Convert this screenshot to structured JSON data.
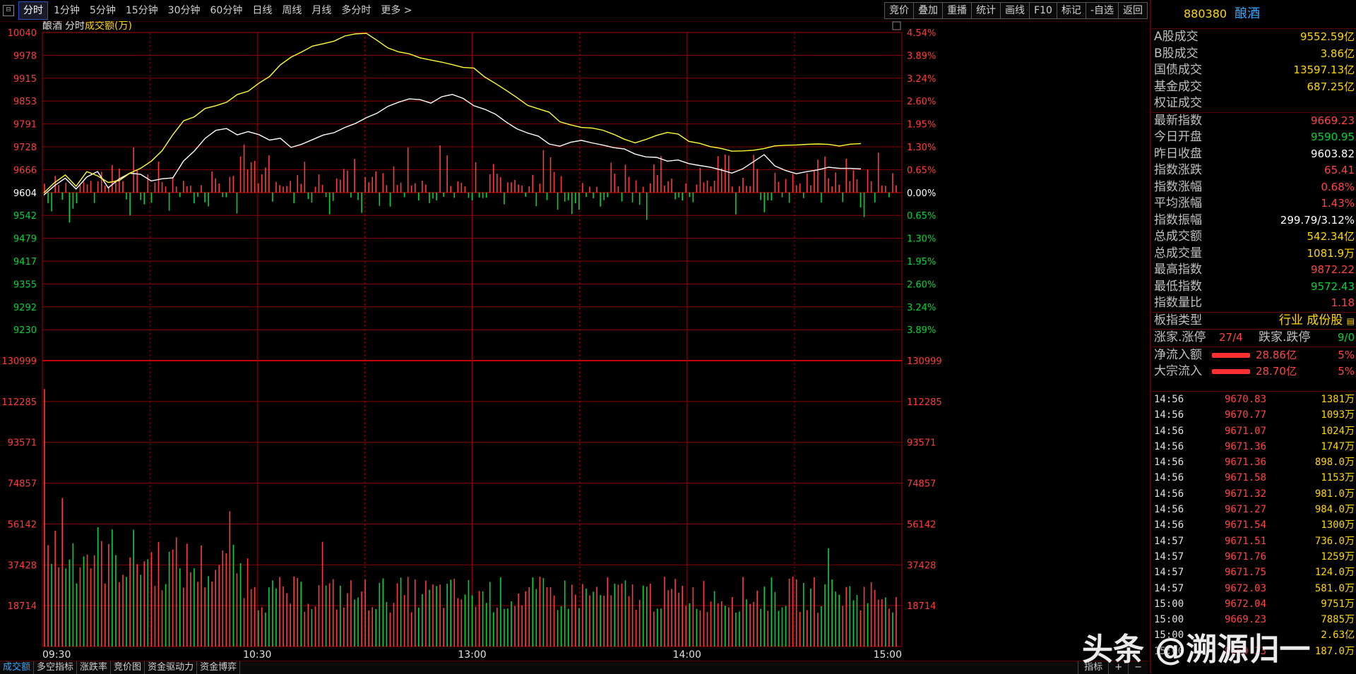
{
  "toolbar": {
    "periods": [
      "分时",
      "1分钟",
      "5分钟",
      "15分钟",
      "30分钟",
      "60分钟",
      "日线",
      "周线",
      "月线",
      "多分时",
      "更多 >"
    ],
    "active_period": "分时",
    "tools": [
      "竞价",
      "叠加",
      "重播",
      "统计",
      "画线",
      "F10",
      "标记",
      "-自选",
      "返回"
    ]
  },
  "chart_header": {
    "name": "酿酒",
    "mode": "分时",
    "vol_label": "成交额(万)"
  },
  "colors": {
    "up": "#ff3b3b",
    "down": "#00d43a",
    "price_line": "#ffffff",
    "avg_line": "#ffff33",
    "grid": "#8b0000",
    "neutral": "#ffffff"
  },
  "chart_data": [
    {
      "type": "line",
      "title": "",
      "xlabel": "",
      "ylabel": "",
      "ylim": [
        9168,
        10040
      ],
      "prev_close": 9604,
      "y_ticks": [
        "10040",
        "9978",
        "9915",
        "9853",
        "9791",
        "9728",
        "9666",
        "9604",
        "9542",
        "9479",
        "9417",
        "9355",
        "9292",
        "9230"
      ],
      "pct_ticks": [
        "4.54%",
        "3.89%",
        "3.24%",
        "2.60%",
        "1.95%",
        "1.30%",
        "0.65%",
        "0.00%",
        "0.65%",
        "1.30%",
        "1.95%",
        "2.60%",
        "3.24%",
        "3.89%"
      ],
      "x_ticks": [
        "09:30",
        "10:30",
        "13:00",
        "14:00",
        "15:00"
      ],
      "series": [
        {
          "name": "price",
          "color": "#ffffff",
          "values": [
            9600,
            9625,
            9640,
            9610,
            9650,
            9660,
            9620,
            9640,
            9660,
            9650,
            9635,
            9640,
            9645,
            9690,
            9720,
            9750,
            9770,
            9775,
            9760,
            9770,
            9760,
            9745,
            9750,
            9730,
            9735,
            9750,
            9760,
            9765,
            9780,
            9790,
            9805,
            9820,
            9840,
            9850,
            9860,
            9855,
            9850,
            9862,
            9870,
            9860,
            9840,
            9830,
            9820,
            9800,
            9780,
            9765,
            9755,
            9740,
            9730,
            9740,
            9745,
            9740,
            9730,
            9725,
            9720,
            9710,
            9700,
            9700,
            9690,
            9695,
            9680,
            9675,
            9670,
            9665,
            9660,
            9670,
            9690,
            9705,
            9680,
            9665,
            9655,
            9660,
            9665,
            9670,
            9668,
            9670,
            9669
          ]
        },
        {
          "name": "average",
          "color": "#ffff33",
          "values": [
            9600,
            9630,
            9650,
            9620,
            9660,
            9650,
            9630,
            9640,
            9660,
            9670,
            9690,
            9720,
            9760,
            9800,
            9810,
            9830,
            9840,
            9850,
            9870,
            9880,
            9900,
            9920,
            9950,
            9970,
            9990,
            10000,
            10010,
            10020,
            10030,
            10040,
            10035,
            10020,
            10000,
            9990,
            9980,
            9970,
            9965,
            9960,
            9950,
            9945,
            9940,
            9920,
            9900,
            9880,
            9860,
            9840,
            9830,
            9820,
            9800,
            9790,
            9785,
            9780,
            9770,
            9760,
            9750,
            9740,
            9745,
            9760,
            9770,
            9760,
            9745,
            9735,
            9730,
            9725,
            9720,
            9715,
            9720,
            9725,
            9728,
            9730,
            9735,
            9738,
            9737,
            9735,
            9733,
            9735,
            9737
          ]
        }
      ]
    },
    {
      "type": "bar",
      "title": "成交额(万)",
      "y_ticks": [
        "130999",
        "112285",
        "93571",
        "74857",
        "56142",
        "37428",
        "18714"
      ],
      "ylim": [
        0,
        130999
      ],
      "x_range": [
        0,
        240
      ],
      "peak_values": [
        {
          "x": 0,
          "y": 118000
        },
        {
          "x": 5,
          "y": 68000
        },
        {
          "x": 52,
          "y": 62000
        },
        {
          "x": 78,
          "y": 48000
        },
        {
          "x": 220,
          "y": 45000
        }
      ],
      "typical_value": 28000
    }
  ],
  "panel": {
    "code": "880380",
    "name": "酿酒",
    "market": [
      {
        "label": "A股成交",
        "value": "9552.59亿"
      },
      {
        "label": "B股成交",
        "value": "3.86亿"
      },
      {
        "label": "国债成交",
        "value": "13597.13亿"
      },
      {
        "label": "基金成交",
        "value": "687.25亿"
      },
      {
        "label": "权证成交",
        "value": ""
      }
    ],
    "index": [
      {
        "label": "最新指数",
        "value": "9669.23",
        "cls": "red"
      },
      {
        "label": "今日开盘",
        "value": "9590.95",
        "cls": "green"
      },
      {
        "label": "昨日收盘",
        "value": "9603.82",
        "cls": "white"
      },
      {
        "label": "指数涨跌",
        "value": "65.41",
        "cls": "red"
      },
      {
        "label": "指数涨幅",
        "value": "0.68%",
        "cls": "red"
      },
      {
        "label": "平均涨幅",
        "value": "1.43%",
        "cls": "red"
      },
      {
        "label": "指数振幅",
        "value": "299.79/3.12%",
        "cls": "white"
      },
      {
        "label": "总成交额",
        "value": "542.34亿",
        "cls": "yellow"
      },
      {
        "label": "总成交量",
        "value": "1081.9万",
        "cls": "yellow"
      },
      {
        "label": "最高指数",
        "value": "9872.22",
        "cls": "red"
      },
      {
        "label": "最低指数",
        "value": "9572.43",
        "cls": "green"
      },
      {
        "label": "指数量比",
        "value": "1.18",
        "cls": "red"
      }
    ],
    "board_type_label": "板指类型",
    "board_type_value": "行业 成份股",
    "up_label": "涨家.涨停",
    "up_value": "27/4",
    "down_label": "跌家.跌停",
    "down_value": "9/0",
    "flows": [
      {
        "label": "净流入额",
        "value": "28.86亿",
        "pct": "5%"
      },
      {
        "label": "大宗流入",
        "value": "28.70亿",
        "pct": "5%"
      }
    ],
    "ticks": [
      {
        "t": "14:56",
        "p": "9670.83",
        "v": "1381万"
      },
      {
        "t": "14:56",
        "p": "9670.77",
        "v": "1093万"
      },
      {
        "t": "14:56",
        "p": "9671.07",
        "v": "1024万"
      },
      {
        "t": "14:56",
        "p": "9671.36",
        "v": "1747万"
      },
      {
        "t": "14:56",
        "p": "9671.36",
        "v": "898.0万"
      },
      {
        "t": "14:56",
        "p": "9671.58",
        "v": "1153万"
      },
      {
        "t": "14:56",
        "p": "9671.32",
        "v": "981.0万"
      },
      {
        "t": "14:56",
        "p": "9671.27",
        "v": "984.0万"
      },
      {
        "t": "14:56",
        "p": "9671.54",
        "v": "1300万"
      },
      {
        "t": "14:57",
        "p": "9671.51",
        "v": "736.0万"
      },
      {
        "t": "14:57",
        "p": "9671.76",
        "v": "1259万"
      },
      {
        "t": "14:57",
        "p": "9671.75",
        "v": "124.0万"
      },
      {
        "t": "14:57",
        "p": "9672.03",
        "v": "581.0万"
      },
      {
        "t": "15:00",
        "p": "9672.04",
        "v": "9751万"
      },
      {
        "t": "15:00",
        "p": "9669.23",
        "v": "7885万"
      },
      {
        "t": "15:00",
        "p": "",
        "v": "2.63亿"
      },
      {
        "t": "15:00",
        "p": "9669.23",
        "v": "187.0万"
      }
    ]
  },
  "bottom_tabs": [
    "成交额",
    "多空指标",
    "涨跌率",
    "竞价图",
    "资金驱动力",
    "资金博弈"
  ],
  "bottom_right": [
    "指标",
    "+",
    "−"
  ],
  "watermark": "头条 @溯源归一"
}
